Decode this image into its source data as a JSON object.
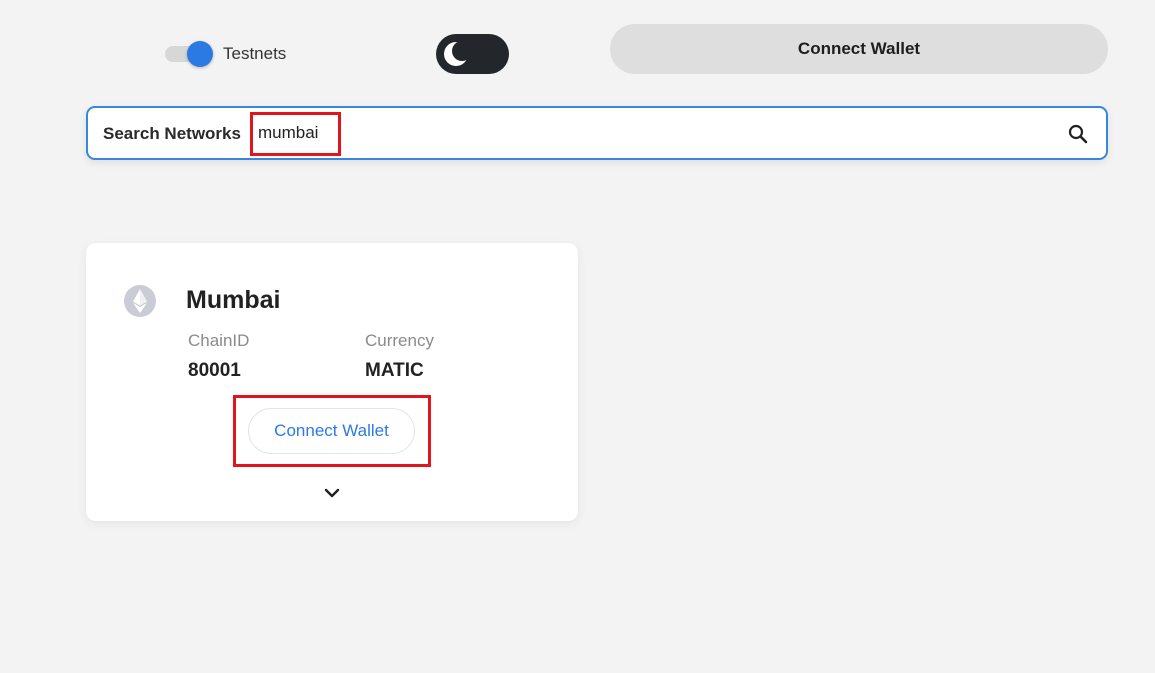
{
  "header": {
    "testnets_label": "Testnets",
    "testnets_enabled": true,
    "theme": "dark",
    "connect_wallet_label": "Connect Wallet"
  },
  "search": {
    "label": "Search Networks",
    "value": "mumbai",
    "icon": "search-icon"
  },
  "networks": [
    {
      "name": "Mumbai",
      "icon": "ethereum-icon",
      "chainid_label": "ChainID",
      "chainid": "80001",
      "currency_label": "Currency",
      "currency": "MATIC",
      "connect_label": "Connect Wallet",
      "expand_icon": "chevron-down-icon"
    }
  ],
  "colors": {
    "accent": "#2b7ae4",
    "highlight": "#e0161c",
    "background": "#f3f3f3"
  }
}
